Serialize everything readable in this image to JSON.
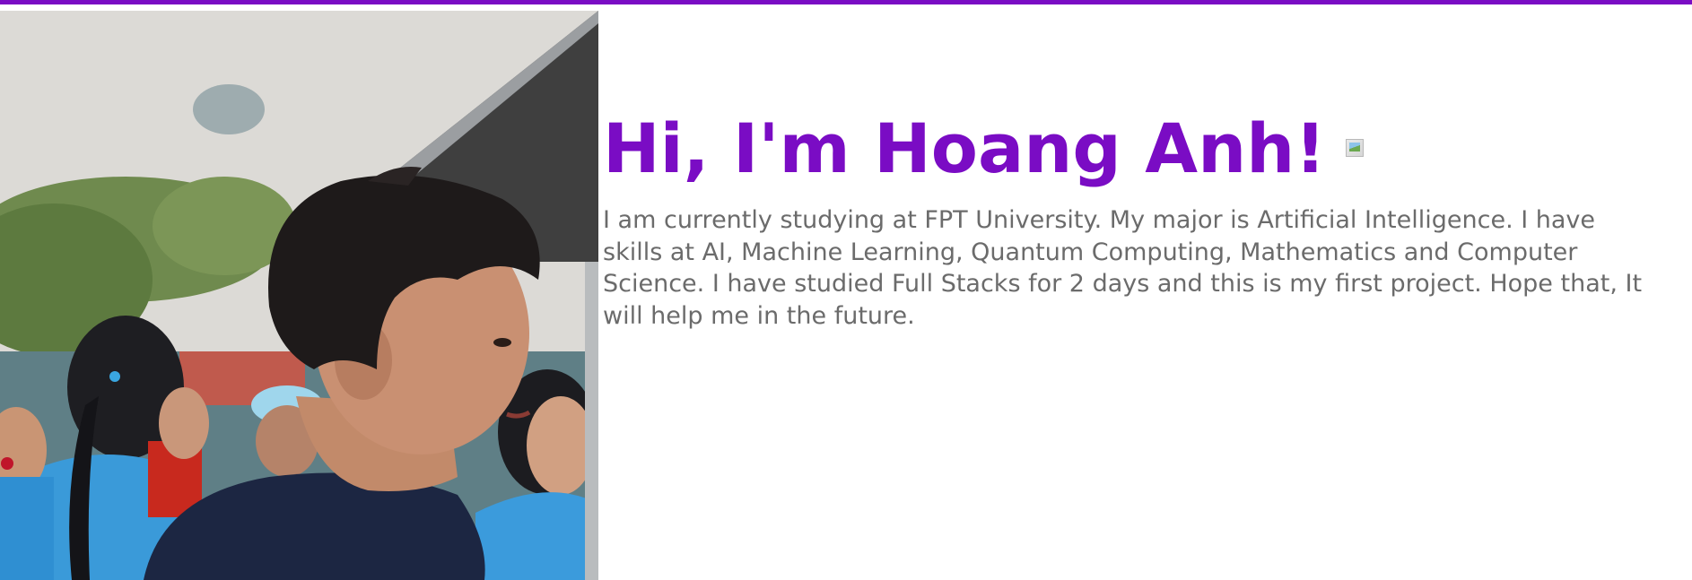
{
  "colors": {
    "accent": "#7a0cc4",
    "text": "#6b6b6b",
    "background": "#ffffff"
  },
  "hero": {
    "title": "Hi, I'm Hoang Anh!",
    "wave_icon": "broken-image-icon",
    "bio": "I am currently studying at FPT University. My major is Artificial Intelligence. I have skills at AI, Machine Learning, Quantum Computing, Mathematics and Computer Science. I have studied Full Stacks for 2 days and this is my first project. Hope that, It will help me in the future.",
    "photo": "profile-photo"
  }
}
